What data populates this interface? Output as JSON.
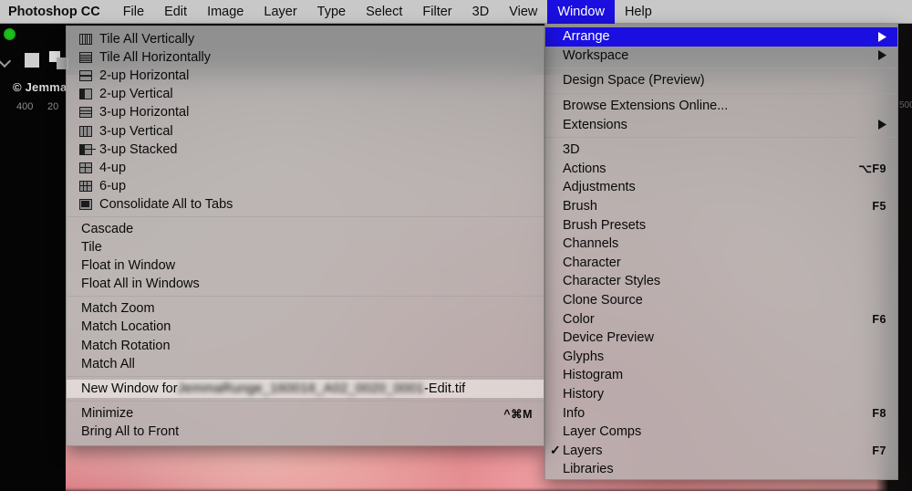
{
  "app": {
    "name": "Photoshop CC",
    "canvas_copyright": "© Jemma",
    "ruler_marks": {
      "left1": "400",
      "left2": "20",
      "right": "500"
    }
  },
  "menubar": {
    "items": [
      {
        "label": "Photoshop CC",
        "active": false,
        "bold": true
      },
      {
        "label": "File",
        "active": false
      },
      {
        "label": "Edit",
        "active": false
      },
      {
        "label": "Image",
        "active": false
      },
      {
        "label": "Layer",
        "active": false
      },
      {
        "label": "Type",
        "active": false
      },
      {
        "label": "Select",
        "active": false
      },
      {
        "label": "Filter",
        "active": false
      },
      {
        "label": "3D",
        "active": false
      },
      {
        "label": "View",
        "active": false
      },
      {
        "label": "Window",
        "active": true
      },
      {
        "label": "Help",
        "active": false
      }
    ]
  },
  "window_menu": {
    "groups": [
      {
        "items": [
          {
            "label": "Arrange",
            "submenu": true,
            "selected": true
          },
          {
            "label": "Workspace",
            "submenu": true
          }
        ]
      },
      {
        "items": [
          {
            "label": "Design Space (Preview)"
          }
        ]
      },
      {
        "items": [
          {
            "label": "Browse Extensions Online..."
          },
          {
            "label": "Extensions",
            "submenu": true
          }
        ]
      },
      {
        "items": [
          {
            "label": "3D"
          },
          {
            "label": "Actions",
            "shortcut": "⌥F9"
          },
          {
            "label": "Adjustments"
          },
          {
            "label": "Brush",
            "shortcut": "F5"
          },
          {
            "label": "Brush Presets"
          },
          {
            "label": "Channels"
          },
          {
            "label": "Character"
          },
          {
            "label": "Character Styles"
          },
          {
            "label": "Clone Source"
          },
          {
            "label": "Color",
            "shortcut": "F6"
          },
          {
            "label": "Device Preview"
          },
          {
            "label": "Glyphs"
          },
          {
            "label": "Histogram"
          },
          {
            "label": "History"
          },
          {
            "label": "Info",
            "shortcut": "F8"
          },
          {
            "label": "Layer Comps"
          },
          {
            "label": "Layers",
            "shortcut": "F7",
            "checked": true
          },
          {
            "label": "Libraries"
          }
        ]
      }
    ]
  },
  "arrange_submenu": {
    "groups": [
      {
        "items": [
          {
            "label": "Tile All Vertically",
            "icon": "tile-all-vertically-icon"
          },
          {
            "label": "Tile All Horizontally",
            "icon": "tile-all-horizontally-icon"
          },
          {
            "label": "2-up Horizontal",
            "icon": "two-up-horizontal-icon"
          },
          {
            "label": "2-up Vertical",
            "icon": "two-up-vertical-icon"
          },
          {
            "label": "3-up Horizontal",
            "icon": "three-up-horizontal-icon"
          },
          {
            "label": "3-up Vertical",
            "icon": "three-up-vertical-icon"
          },
          {
            "label": "3-up Stacked",
            "icon": "three-up-stacked-icon"
          },
          {
            "label": "4-up",
            "icon": "four-up-icon"
          },
          {
            "label": "6-up",
            "icon": "six-up-icon"
          },
          {
            "label": "Consolidate All to Tabs",
            "icon": "consolidate-all-to-tabs-icon"
          }
        ]
      },
      {
        "items": [
          {
            "label": "Cascade"
          },
          {
            "label": "Tile"
          },
          {
            "label": "Float in Window"
          },
          {
            "label": "Float All in Windows"
          }
        ]
      },
      {
        "items": [
          {
            "label": "Match Zoom"
          },
          {
            "label": "Match Location"
          },
          {
            "label": "Match Rotation"
          },
          {
            "label": "Match All"
          }
        ]
      },
      {
        "items": [
          {
            "label": "New Window for ",
            "filename_redacted": "JemmaRunge_160016_A02_0020_0001",
            "filename_suffix": "-Edit.tif",
            "highlight": true
          }
        ]
      },
      {
        "items": [
          {
            "label": "Minimize",
            "shortcut": "^⌘M"
          },
          {
            "label": "Bring All to Front"
          }
        ]
      }
    ]
  },
  "colors": {
    "menubar_bg": "#c8c8c8",
    "highlight_blue": "#1a0fe0",
    "menu_panel_bg": "#b0b0b0",
    "text": "#0a0a0a",
    "window_dot_green": "#1fc11f"
  }
}
